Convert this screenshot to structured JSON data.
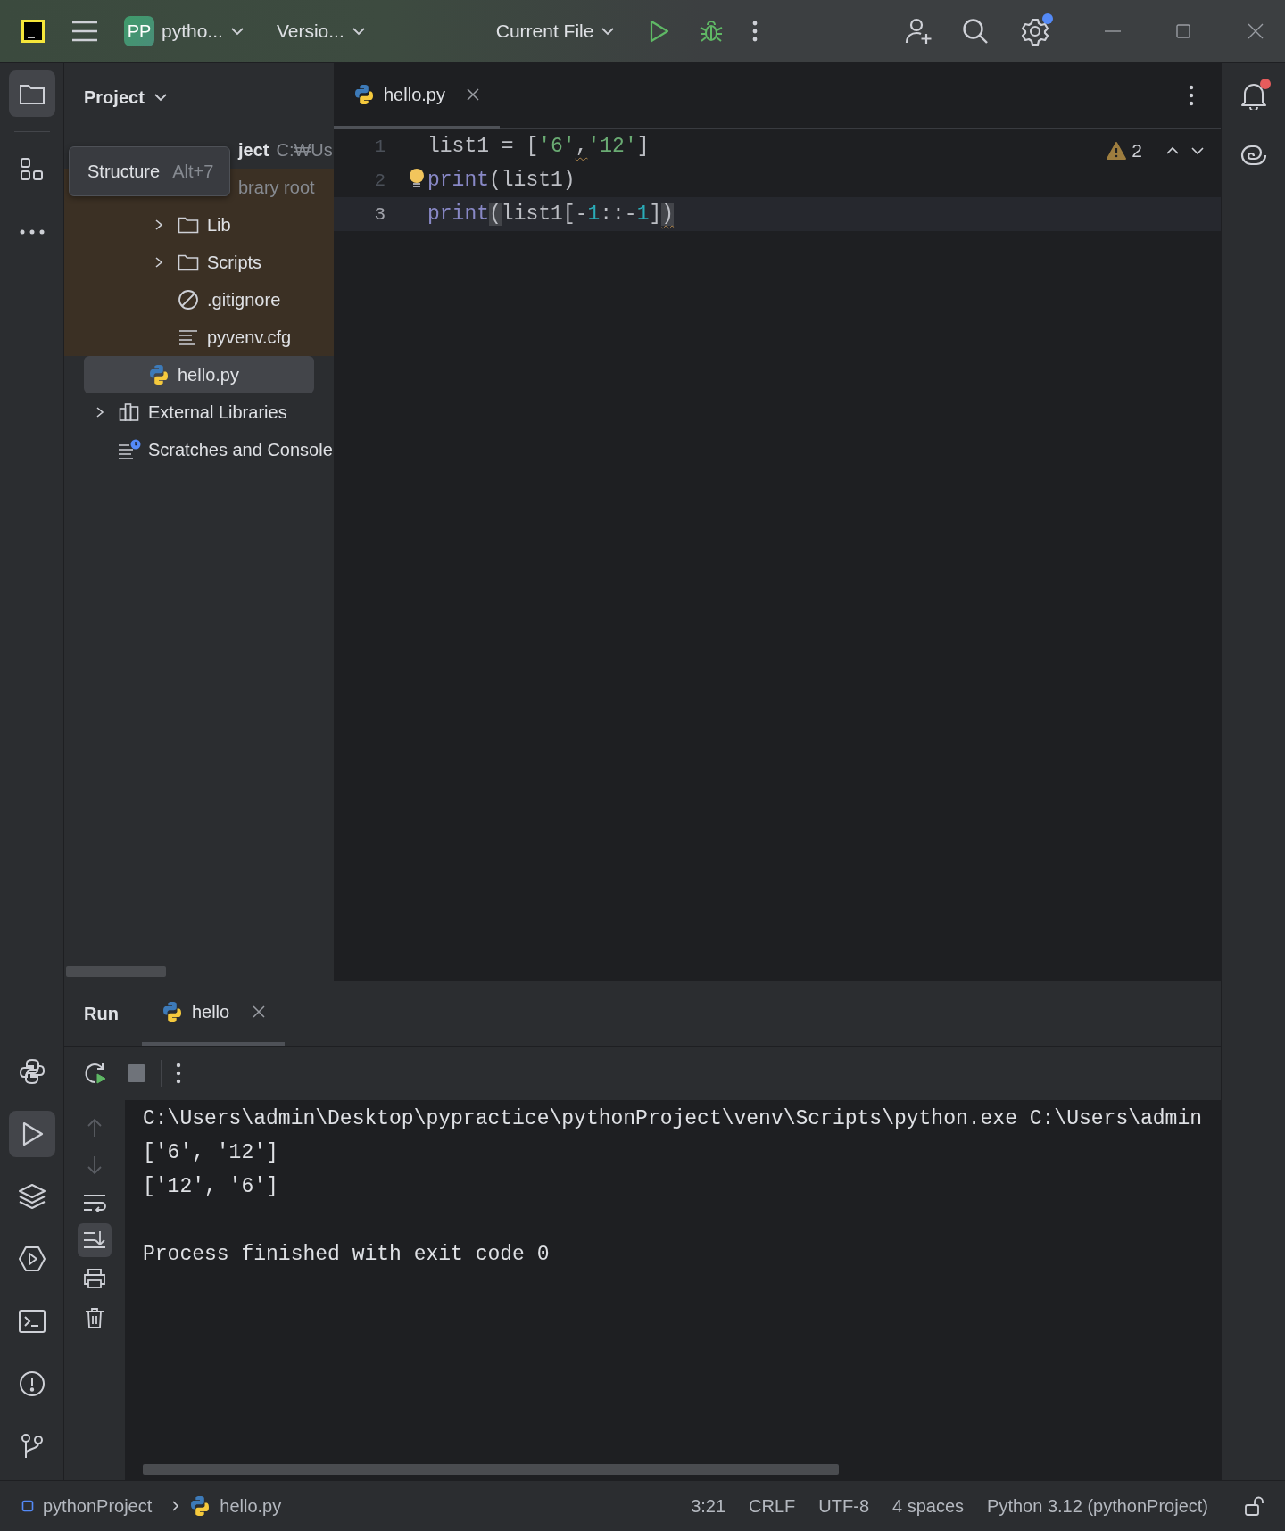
{
  "title_bar": {
    "project_badge": "PP",
    "project": "pytho...",
    "vcs": "Versio...",
    "run_config": "Current File",
    "settings_notification": true
  },
  "left_toolbar": {
    "top": [
      {
        "kind": "project",
        "selected": true
      },
      {
        "kind": "structure",
        "selected": false
      },
      {
        "kind": "more",
        "selected": false
      }
    ],
    "bottom": [
      {
        "kind": "python-console",
        "selected": false
      },
      {
        "kind": "run",
        "selected": true
      },
      {
        "kind": "layers",
        "selected": false
      },
      {
        "kind": "services",
        "selected": false
      },
      {
        "kind": "terminal",
        "selected": false
      },
      {
        "kind": "problems",
        "selected": false
      },
      {
        "kind": "git",
        "selected": false
      }
    ]
  },
  "project_panel": {
    "title": "Project",
    "tree": [
      {
        "name": "ject",
        "path": "C:₩Us",
        "selected": false,
        "children": [
          {
            "hint": "brary root",
            "library_root": true,
            "selected": false,
            "children": [
              {
                "name": "Lib",
                "kind": "folder",
                "expanded": false,
                "selected": false
              },
              {
                "name": "Scripts",
                "kind": "folder",
                "expanded": false,
                "selected": false
              },
              {
                "name": ".gitignore",
                "kind": "ignore",
                "selected": false
              },
              {
                "name": "pyvenv.cfg",
                "kind": "text",
                "selected": false
              }
            ]
          },
          {
            "name": "hello.py",
            "kind": "python",
            "selected": true
          }
        ]
      },
      {
        "name": "External Libraries",
        "kind": "libraries",
        "expanded": false,
        "selected": false
      },
      {
        "name": "Scratches and Console",
        "kind": "scratches",
        "selected": false
      }
    ]
  },
  "tooltip": {
    "label": "Structure",
    "shortcut": "Alt+7"
  },
  "editor": {
    "tabs": [
      {
        "label": "hello.py",
        "selected": true
      }
    ],
    "warnings": "2",
    "lines": [
      {
        "number": "1",
        "current": false,
        "bulb": false,
        "tokens": [
          {
            "text": "list1 = [",
            "kind": "plain"
          },
          {
            "text": "'6'",
            "kind": "string"
          },
          {
            "text": ",",
            "kind": "plain",
            "warning": true
          },
          {
            "text": "'12'",
            "kind": "string"
          },
          {
            "text": "]",
            "kind": "plain"
          }
        ]
      },
      {
        "number": "2",
        "current": false,
        "bulb": true,
        "tokens": [
          {
            "text": "print",
            "kind": "builtin"
          },
          {
            "text": "(list1)",
            "kind": "plain"
          }
        ]
      },
      {
        "number": "3",
        "current": true,
        "bulb": false,
        "tokens": [
          {
            "text": "print",
            "kind": "builtin"
          },
          {
            "text": "(",
            "kind": "plain",
            "matched": true
          },
          {
            "text": "list1[-",
            "kind": "plain"
          },
          {
            "text": "1",
            "kind": "number"
          },
          {
            "text": "::-",
            "kind": "plain"
          },
          {
            "text": "1",
            "kind": "number"
          },
          {
            "text": "]",
            "kind": "plain"
          },
          {
            "text": ")",
            "kind": "plain",
            "matched": true,
            "warning": true
          }
        ]
      }
    ]
  },
  "right_toolbar": {
    "notification": true
  },
  "run_panel": {
    "title": "Run",
    "tabs": [
      {
        "label": "hello",
        "selected": true
      }
    ],
    "scroll_to_end": true,
    "output": [
      {
        "text": "C:\\Users\\admin\\Desktop\\pypractice\\pythonProject\\venv\\Scripts\\python.exe C:\\Users\\admin",
        "kind": "command"
      },
      {
        "text": "['6', '12']",
        "kind": "stdout"
      },
      {
        "text": "['12', '6']",
        "kind": "stdout"
      },
      {
        "text": "Process finished with exit code 0",
        "kind": "status"
      }
    ]
  },
  "status_bar": {
    "breadcrumbs": [
      "pythonProject",
      "hello.py"
    ],
    "position": "3:21",
    "line_separator": "CRLF",
    "encoding": "UTF-8",
    "indent": "4 spaces",
    "interpreter": "Python 3.12 (pythonProject)"
  }
}
